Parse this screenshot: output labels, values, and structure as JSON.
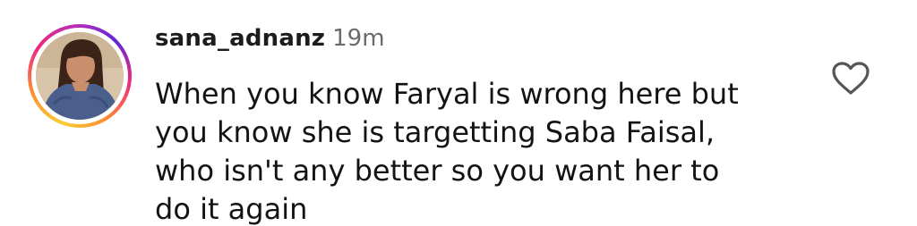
{
  "comment": {
    "username": "sana_adnanz",
    "timestamp": "19m",
    "text_lines": [
      "When you know Faryal is wrong here but",
      "you know she is targetting Saba Faisal,",
      "who isn't any better so you want her to",
      "do it again"
    ],
    "like_icon": "heart-outline-icon"
  },
  "colors": {
    "story_ring": [
      "#f9ce34",
      "#ee2a7b",
      "#6228d7"
    ],
    "text": "#131313",
    "timestamp": "#6b6b6b",
    "icon": "#555555"
  }
}
